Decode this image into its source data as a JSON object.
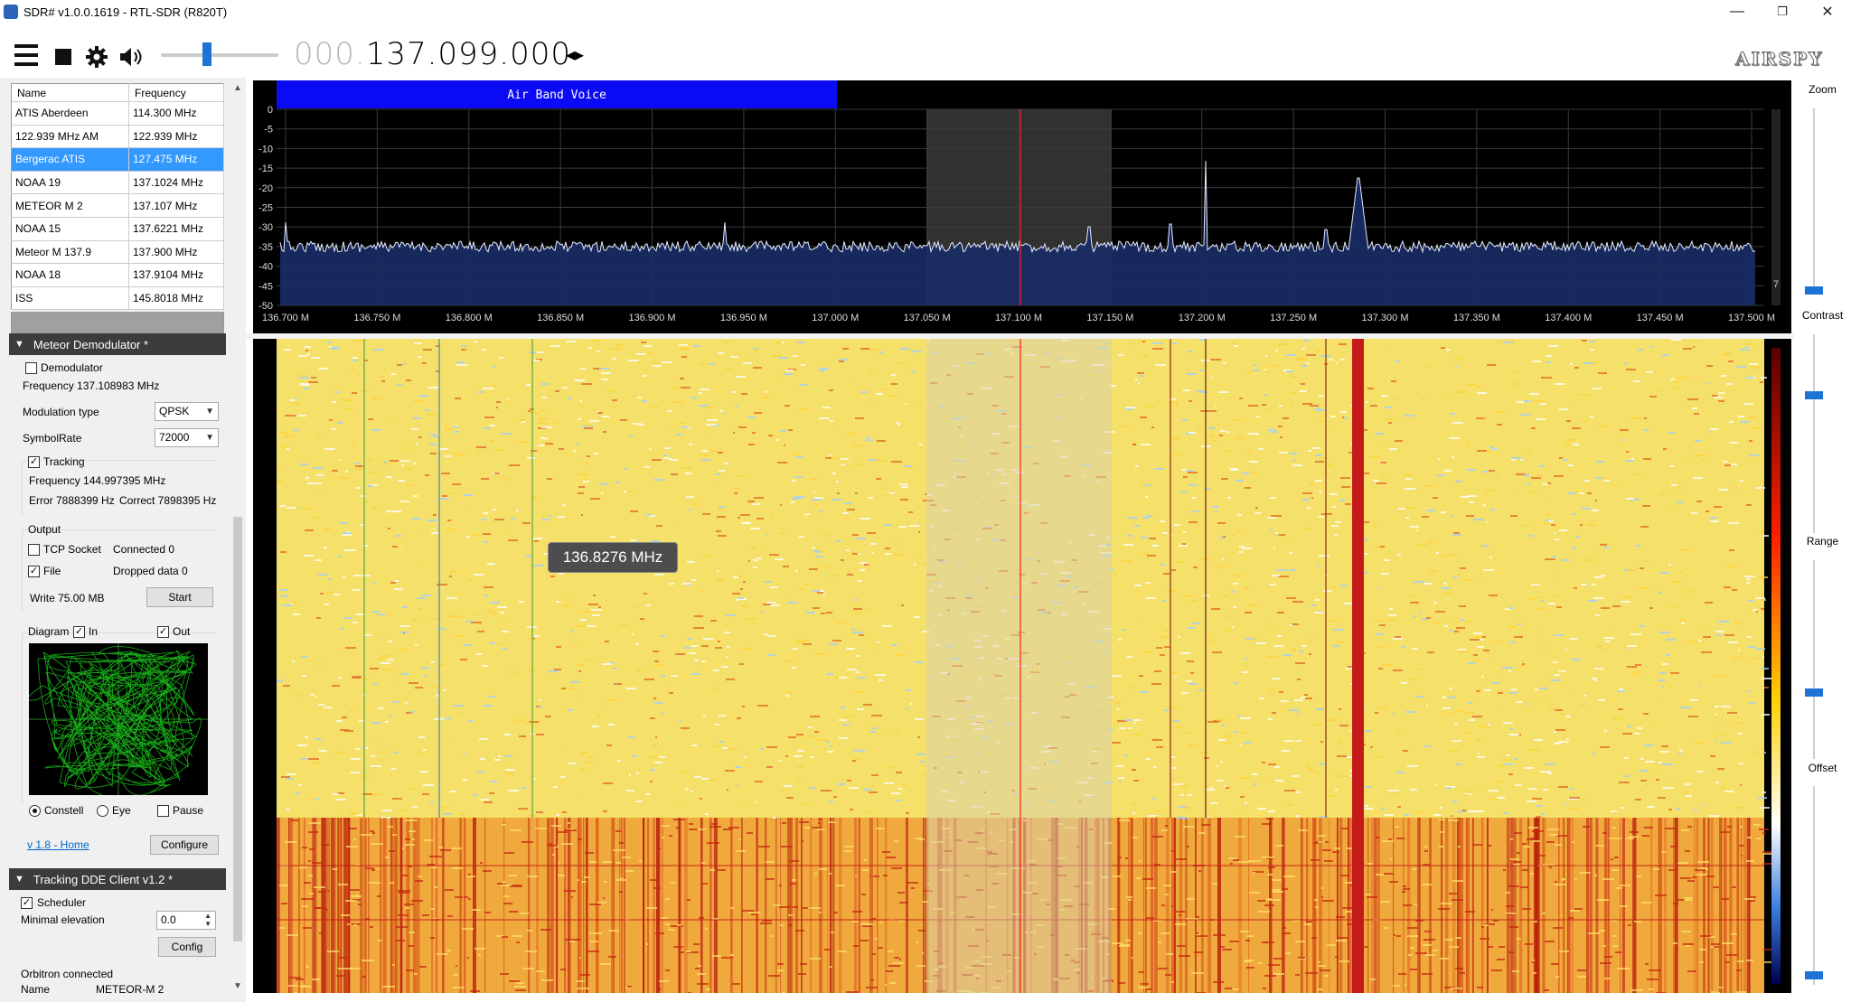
{
  "window": {
    "title": "SDR# v1.0.0.1619 - RTL-SDR (R820T)",
    "min_glyph": "—",
    "restore_glyph": "❐",
    "close_glyph": "✕"
  },
  "toolbar": {
    "freq_dim": "000.",
    "freq_main": "137.099.000",
    "freq_arrows": "◂▸",
    "logo": "AIRSPY"
  },
  "freq_list": {
    "headers": [
      "Name",
      "Frequency"
    ],
    "rows": [
      [
        "ATIS Aberdeen",
        "114.300 MHz"
      ],
      [
        "122.939 MHz AM",
        "122.939 MHz"
      ],
      [
        "Bergerac ATIS",
        "127.475 MHz"
      ],
      [
        "NOAA 19",
        "137.1024 MHz"
      ],
      [
        "METEOR M 2",
        "137.107 MHz"
      ],
      [
        "NOAA 15",
        "137.6221 MHz"
      ],
      [
        "Meteor M 137.9",
        "137.900 MHz"
      ],
      [
        "NOAA 18",
        "137.9104 MHz"
      ],
      [
        "ISS",
        "145.8018 MHz"
      ]
    ],
    "selected_index": 2
  },
  "meteor": {
    "title": "Meteor Demodulator *",
    "demodulator_label": "Demodulator",
    "frequency_text": "Frequency 137.108983 MHz",
    "modulation_label": "Modulation type",
    "modulation_value": "QPSK",
    "symbolrate_label": "SymbolRate",
    "symbolrate_value": "72000",
    "tracking_label": "Tracking",
    "tracking_freq": "Frequency 144.997395 MHz",
    "error_text": "Error 7888399 Hz",
    "correct_text": "Correct 7898395 Hz",
    "output_label": "Output",
    "tcp_label": "TCP Socket",
    "connected_text": "Connected 0",
    "file_label": "File",
    "dropped_text": "Dropped data 0",
    "write_text": "Write 75.00 MB",
    "start_label": "Start",
    "diagram_label": "Diagram",
    "in_label": "In",
    "out_label": "Out",
    "constell_label": "Constell",
    "eye_label": "Eye",
    "pause_label": "Pause",
    "home_link": "v 1.8 - Home",
    "configure_label": "Configure"
  },
  "tracking": {
    "title": "Tracking DDE Client v1.2 *",
    "scheduler_label": "Scheduler",
    "min_elev_label": "Minimal elevation",
    "min_elev_value": "0.0",
    "config_label": "Config",
    "orbitron_text": "Orbitron connected",
    "name_label": "Name",
    "name_value": "METEOR-M  2"
  },
  "spectrum": {
    "band_label": "Air Band Voice",
    "db_labels": [
      "0",
      "-5",
      "-10",
      "-15",
      "-20",
      "-25",
      "-30",
      "-35",
      "-40",
      "-45",
      "-50"
    ],
    "freq_labels": [
      "136.700 M",
      "136.750 M",
      "136.800 M",
      "136.850 M",
      "136.900 M",
      "136.950 M",
      "137.000 M",
      "137.050 M",
      "137.100 M",
      "137.150 M",
      "137.200 M",
      "137.250 M",
      "137.300 M",
      "137.350 M",
      "137.400 M",
      "137.450 M",
      "137.500 M"
    ],
    "side_value": "7"
  },
  "waterfall": {
    "tooltip": "136.8276 MHz"
  },
  "right_panel": {
    "zoom_label": "Zoom",
    "contrast_label": "Contrast",
    "range_label": "Range",
    "offset_label": "Offset"
  },
  "colors": {
    "accent": "#1e74d6",
    "band_bar": "#0a0af5",
    "selection": "#3399ff",
    "section_header": "#3c3c3c",
    "spectrum_fill": "#1a2d66",
    "filter_band": "#5a5a5a",
    "center_line": "#ff2020",
    "waterfall_base": "#f5e06a",
    "waterfall_hot": "#c41a1a"
  },
  "icons": {
    "menu": "hamburger-icon",
    "stop": "stop-icon",
    "settings": "gear-icon",
    "audio": "speaker-icon"
  }
}
